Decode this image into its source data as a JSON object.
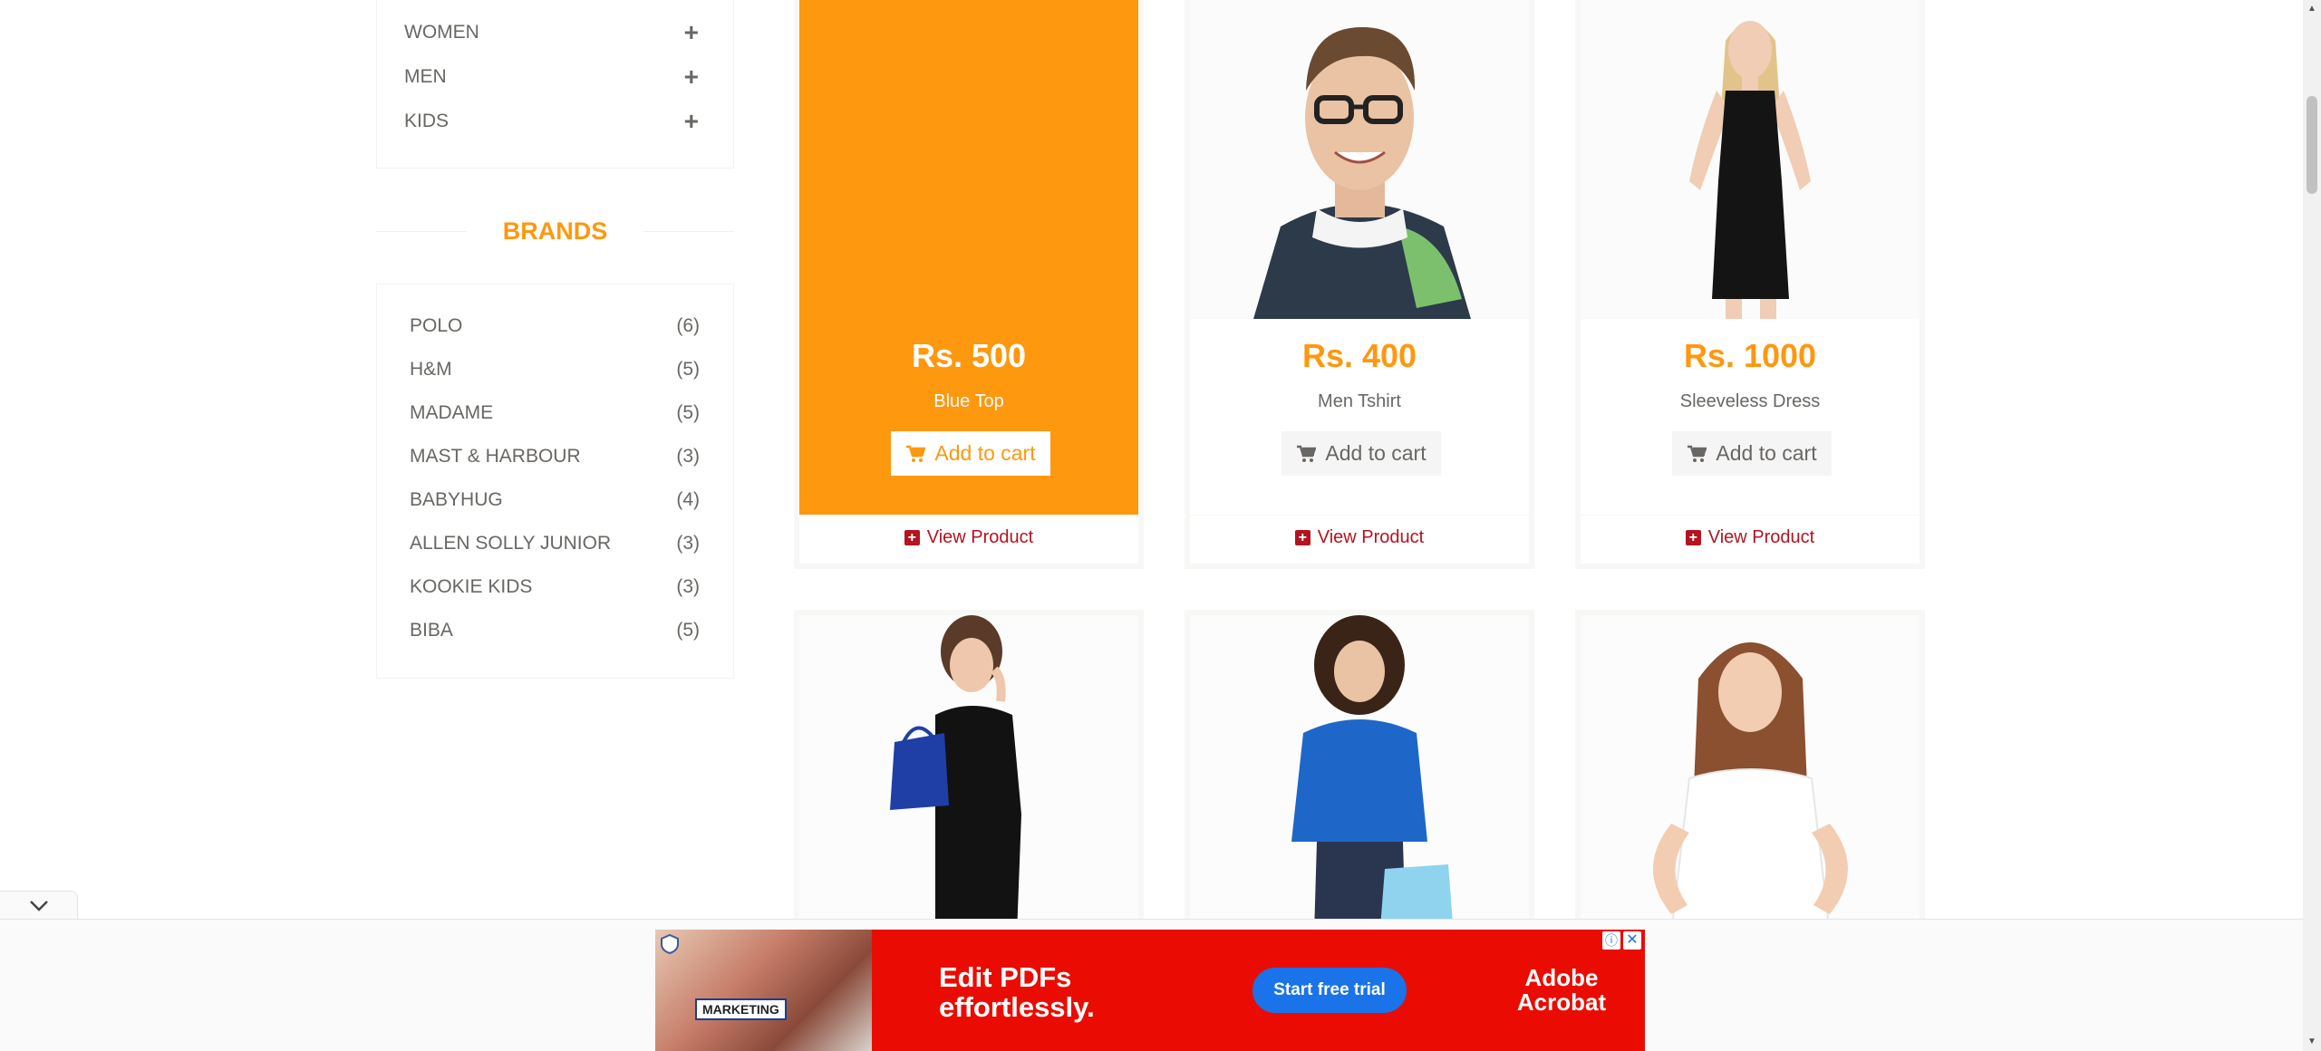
{
  "categories": [
    {
      "label": "Women"
    },
    {
      "label": "Men"
    },
    {
      "label": "Kids"
    }
  ],
  "brands": {
    "title": "Brands",
    "items": [
      {
        "name": "Polo",
        "count": "(6)"
      },
      {
        "name": "H&M",
        "count": "(5)"
      },
      {
        "name": "Madame",
        "count": "(5)"
      },
      {
        "name": "Mast & Harbour",
        "count": "(3)"
      },
      {
        "name": "Babyhug",
        "count": "(4)"
      },
      {
        "name": "Allen Solly Junior",
        "count": "(3)"
      },
      {
        "name": "Kookie Kids",
        "count": "(3)"
      },
      {
        "name": "Biba",
        "count": "(5)"
      }
    ]
  },
  "products": [
    {
      "price": "Rs. 500",
      "name": "Blue Top",
      "cart_label": "Add to cart",
      "view_label": "View Product"
    },
    {
      "price": "Rs. 400",
      "name": "Men Tshirt",
      "cart_label": "Add to cart",
      "view_label": "View Product"
    },
    {
      "price": "Rs. 1000",
      "name": "Sleeveless Dress",
      "cart_label": "Add to cart",
      "view_label": "View Product"
    }
  ],
  "ad": {
    "photo_caption": "MARKETING",
    "headline": "Edit PDFs effortlessly.",
    "cta": "Start free trial",
    "brand": "Adobe Acrobat"
  },
  "colors": {
    "accent": "#fe980f",
    "text": "#696763",
    "link": "#b3141f",
    "ad_bg": "#ea0c02",
    "ad_cta": "#1a73e8"
  }
}
